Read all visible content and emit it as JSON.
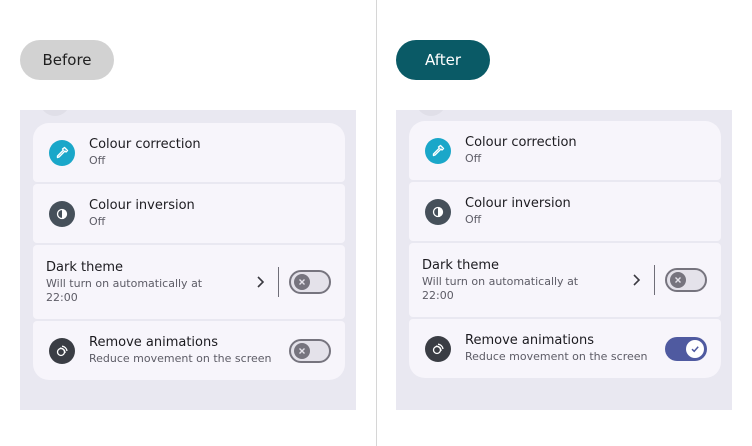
{
  "labels": {
    "before": "Before",
    "after": "After"
  },
  "before": {
    "colour_correction": {
      "title": "Colour correction",
      "status": "Off",
      "icon": "eyedropper-icon"
    },
    "colour_inversion": {
      "title": "Colour inversion",
      "status": "Off",
      "icon": "contrast-icon"
    },
    "dark_theme": {
      "title": "Dark theme",
      "subtitle": "Will turn on automatically at 22:00",
      "toggle": "off"
    },
    "remove_animations": {
      "title": "Remove animations",
      "subtitle": "Reduce movement on the screen",
      "icon": "animation-icon",
      "toggle": "off"
    }
  },
  "after": {
    "colour_correction": {
      "title": "Colour correction",
      "status": "Off",
      "icon": "eyedropper-icon"
    },
    "colour_inversion": {
      "title": "Colour inversion",
      "status": "Off",
      "icon": "contrast-icon"
    },
    "dark_theme": {
      "title": "Dark theme",
      "subtitle": "Will turn on automatically at 22:00",
      "toggle": "off"
    },
    "remove_animations": {
      "title": "Remove animations",
      "subtitle": "Reduce movement on the screen",
      "icon": "animation-icon",
      "toggle": "on"
    }
  },
  "colors": {
    "after_pill": "#0a5a66",
    "before_pill": "#d2d2d2",
    "toggle_on": "#4f5aa0",
    "icon_teal": "#1aa7c9"
  }
}
